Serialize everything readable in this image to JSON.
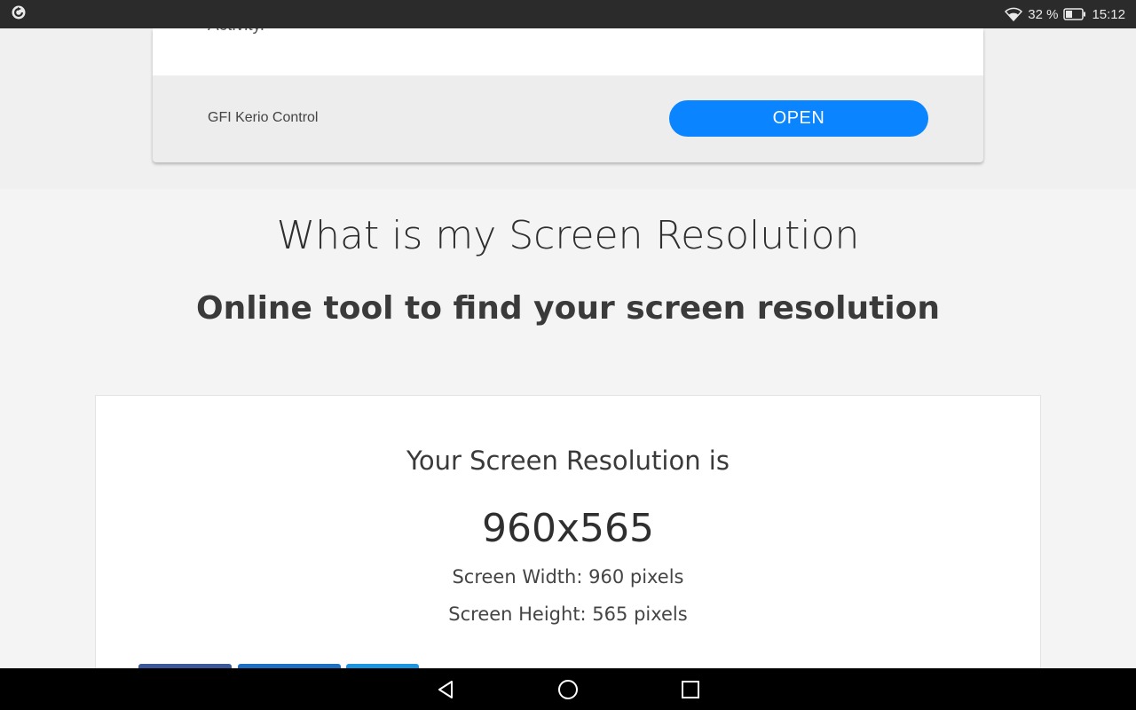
{
  "status_bar": {
    "battery": "32 %",
    "time": "15:12"
  },
  "ad": {
    "top_text_fragment": "Activity.",
    "name": "GFI Kerio Control",
    "open_label": "OPEN",
    "button_color": "#0a84ff"
  },
  "header": {
    "title": "What is my Screen Resolution",
    "subtitle": "Online tool to find your screen resolution"
  },
  "result": {
    "label": "Your Screen Resolution is",
    "value": "960x565",
    "width_line": "Screen Width: 960 pixels",
    "height_line": "Screen Height: 565 pixels"
  },
  "share_buttons": {
    "colors": [
      "#3b5998",
      "#1d6fc4",
      "#1b95e0"
    ]
  },
  "nav_bar": {
    "icons": [
      "back-icon",
      "home-icon",
      "recents-icon"
    ]
  }
}
